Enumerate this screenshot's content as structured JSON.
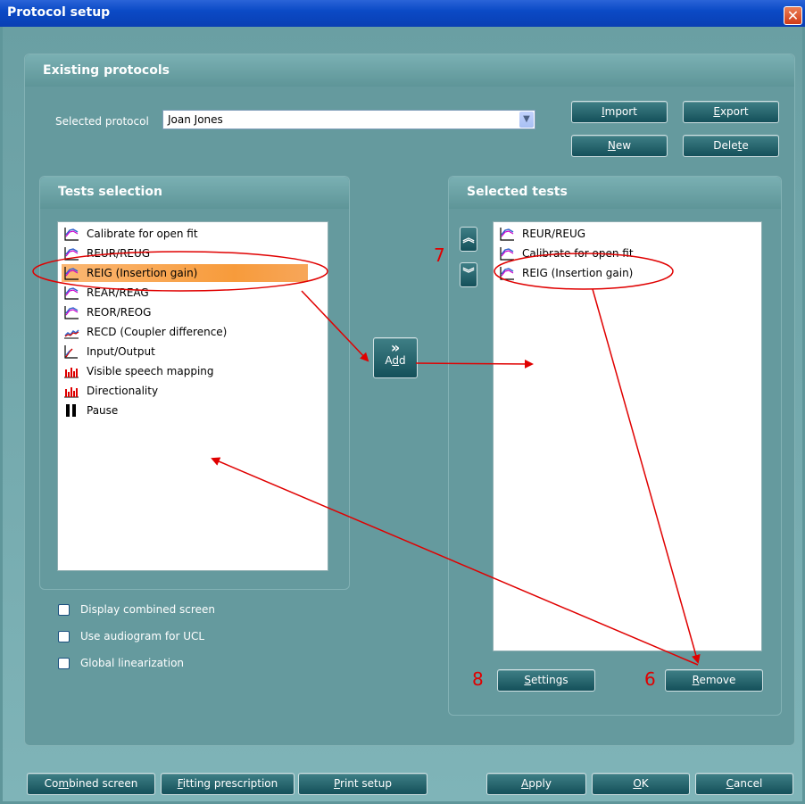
{
  "window": {
    "title": "Protocol setup"
  },
  "existing": {
    "heading": "Existing protocols",
    "selected_label": "Selected protocol",
    "selected_value": "Joan Jones"
  },
  "buttons": {
    "import": {
      "pre": "",
      "u": "I",
      "post": "mport"
    },
    "export": {
      "pre": "",
      "u": "E",
      "post": "xport"
    },
    "new": {
      "pre": "",
      "u": "N",
      "post": "ew"
    },
    "delete": {
      "pre": "Dele",
      "u": "t",
      "post": "e"
    },
    "add": {
      "top": "»",
      "pre": "A",
      "u": "d",
      "post": "d"
    },
    "settings": {
      "pre": "",
      "u": "S",
      "post": "ettings"
    },
    "remove": {
      "pre": "",
      "u": "R",
      "post": "emove"
    },
    "combined": {
      "pre": "Co",
      "u": "m",
      "post": "bined screen"
    },
    "fitting": {
      "pre": "",
      "u": "F",
      "post": "itting prescription"
    },
    "print": {
      "pre": "",
      "u": "P",
      "post": "rint setup"
    },
    "apply": {
      "pre": "",
      "u": "A",
      "post": "pply"
    },
    "ok": {
      "pre": "",
      "u": "O",
      "post": "K"
    },
    "cancel": {
      "pre": "",
      "u": "C",
      "post": "ancel"
    }
  },
  "tests_selection": {
    "heading": "Tests selection",
    "items": [
      {
        "label": "Calibrate for open fit",
        "icon": "curve-chart-icon",
        "selected": false
      },
      {
        "label": "REUR/REUG",
        "icon": "curve-chart-icon",
        "selected": false
      },
      {
        "label": "REIG (Insertion gain)",
        "icon": "curve-chart-icon",
        "selected": true
      },
      {
        "label": "REAR/REAG",
        "icon": "curve-chart-icon",
        "selected": false
      },
      {
        "label": "REOR/REOG",
        "icon": "curve-chart-icon",
        "selected": false
      },
      {
        "label": "RECD (Coupler difference)",
        "icon": "recd-chart-icon",
        "selected": false
      },
      {
        "label": "Input/Output",
        "icon": "io-chart-icon",
        "selected": false
      },
      {
        "label": "Visible speech mapping",
        "icon": "bar-chart-icon",
        "selected": false
      },
      {
        "label": "Directionality",
        "icon": "bar-chart-icon",
        "selected": false
      },
      {
        "label": "Pause",
        "icon": "pause-icon",
        "selected": false
      }
    ]
  },
  "selected_tests": {
    "heading": "Selected tests",
    "items": [
      {
        "label": "REUR/REUG",
        "icon": "curve-chart-icon"
      },
      {
        "label": "Calibrate for open fit",
        "icon": "curve-chart-icon"
      },
      {
        "label": "REIG (Insertion gain)",
        "icon": "curve-chart-icon"
      }
    ],
    "move_up_icon": "double-chevron-up-icon",
    "move_down_icon": "double-chevron-down-icon"
  },
  "options": [
    {
      "label": "Display combined screen",
      "checked": false
    },
    {
      "label": "Use audiogram for UCL",
      "checked": false
    },
    {
      "label": "Global linearization",
      "checked": false
    }
  ],
  "annotations": {
    "n7": "7",
    "n8": "8",
    "n6": "6",
    "color": "#e00000"
  },
  "colors": {
    "title_bar": "#0b4ac6",
    "panel": "#659a9e",
    "selection": "#f79b3b",
    "button": "#14505a"
  }
}
